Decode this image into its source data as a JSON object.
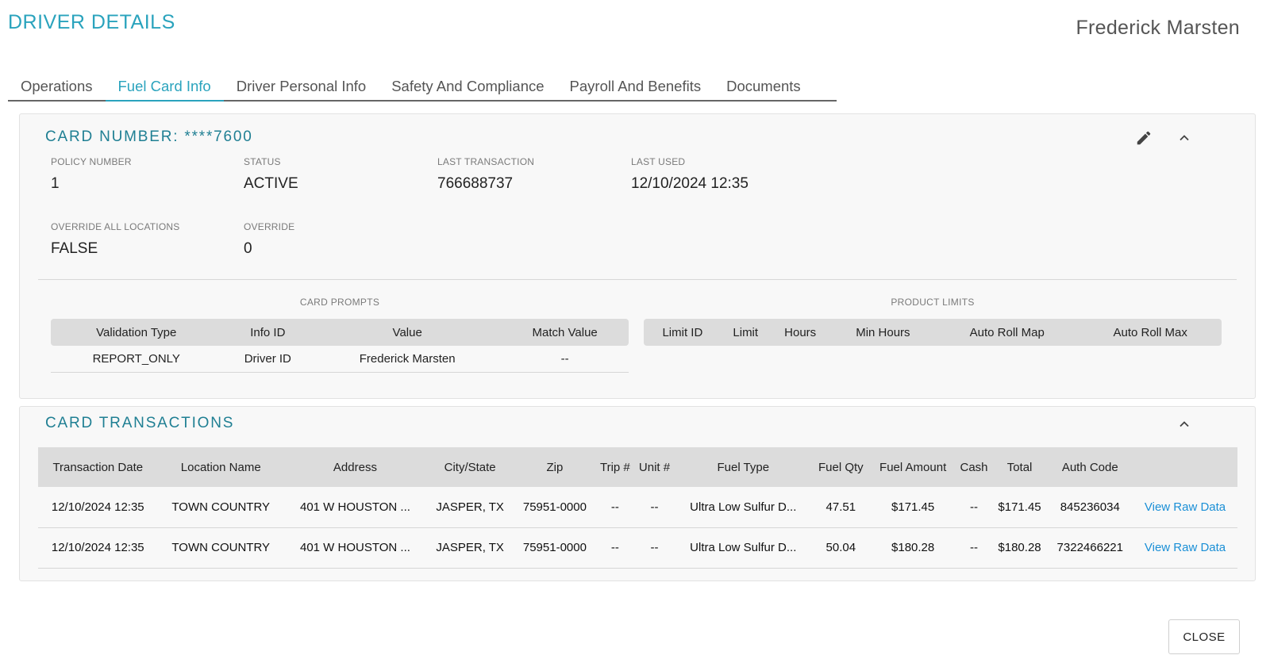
{
  "header": {
    "title": "DRIVER DETAILS",
    "driver_name": "Frederick Marsten"
  },
  "tabs": [
    {
      "label": "Operations",
      "active": false
    },
    {
      "label": "Fuel Card Info",
      "active": true
    },
    {
      "label": "Driver Personal Info",
      "active": false
    },
    {
      "label": "Safety And Compliance",
      "active": false
    },
    {
      "label": "Payroll And Benefits",
      "active": false
    },
    {
      "label": "Documents",
      "active": false
    }
  ],
  "card": {
    "title": "CARD NUMBER: ****7600",
    "edit_icon": "pencil-icon",
    "collapse_icon": "chevron-up-icon",
    "fields": [
      {
        "label": "POLICY NUMBER",
        "value": "1"
      },
      {
        "label": "STATUS",
        "value": "ACTIVE"
      },
      {
        "label": "LAST TRANSACTION",
        "value": "766688737"
      },
      {
        "label": "LAST USED",
        "value": "12/10/2024 12:35"
      },
      {
        "label": "OVERRIDE ALL LOCATIONS",
        "value": "FALSE"
      },
      {
        "label": "OVERRIDE",
        "value": "0"
      }
    ],
    "prompts": {
      "heading": "CARD PROMPTS",
      "columns": [
        "Validation Type",
        "Info ID",
        "Value",
        "Match Value"
      ],
      "rows": [
        [
          "REPORT_ONLY",
          "Driver ID",
          "Frederick Marsten",
          "--"
        ]
      ]
    },
    "limits": {
      "heading": "PRODUCT LIMITS",
      "columns": [
        "Limit ID",
        "Limit",
        "Hours",
        "Min Hours",
        "Auto Roll Map",
        "Auto Roll Max"
      ]
    }
  },
  "transactions": {
    "title": "CARD TRANSACTIONS",
    "collapse_icon": "chevron-up-icon",
    "columns": [
      "Transaction Date",
      "Location Name",
      "Address",
      "City/State",
      "Zip",
      "Trip #",
      "Unit #",
      "Fuel Type",
      "Fuel Qty",
      "Fuel Amount",
      "Cash",
      "Total",
      "Auth Code",
      ""
    ],
    "rows": [
      [
        "12/10/2024 12:35",
        "TOWN COUNTRY",
        "401 W HOUSTON ...",
        "JASPER, TX",
        "75951-0000",
        "--",
        "--",
        "Ultra Low Sulfur D...",
        "47.51",
        "$171.45",
        "--",
        "$171.45",
        "845236034",
        "View Raw Data"
      ],
      [
        "12/10/2024 12:35",
        "TOWN COUNTRY",
        "401 W HOUSTON ...",
        "JASPER, TX",
        "75951-0000",
        "--",
        "--",
        "Ultra Low Sulfur D...",
        "50.04",
        "$180.28",
        "--",
        "$180.28",
        "7322466221",
        "View Raw Data"
      ]
    ]
  },
  "footer": {
    "close_label": "CLOSE"
  }
}
